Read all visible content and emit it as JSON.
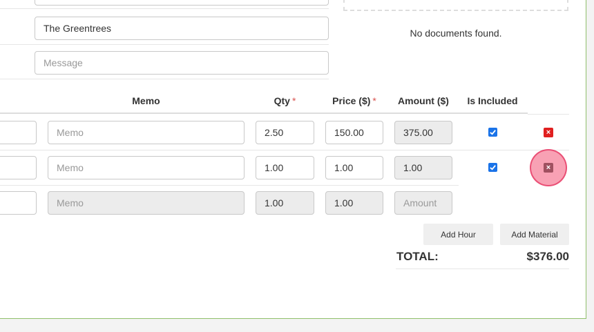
{
  "top_fields": {
    "field_1_value": "",
    "address_value": "The Greentrees",
    "message_placeholder": "Message"
  },
  "documents": {
    "empty_text": "No documents found."
  },
  "table": {
    "headers": {
      "memo": "Memo",
      "qty": "Qty",
      "price": "Price ($)",
      "amount": "Amount ($)",
      "included": "Is Included"
    },
    "required_marker": "*",
    "rows": [
      {
        "memo_placeholder": "Memo",
        "qty": "2.50",
        "price": "150.00",
        "amount": "375.00",
        "included": true
      },
      {
        "memo_placeholder": "Memo",
        "qty": "1.00",
        "price": "1.00",
        "amount": "1.00",
        "included": true
      },
      {
        "memo_placeholder": "Memo",
        "qty": "1.00",
        "price": "1.00",
        "amount_placeholder": "Amount"
      }
    ]
  },
  "actions": {
    "add_hour": "Add Hour",
    "add_material": "Add Material"
  },
  "totals": {
    "label": "TOTAL:",
    "value": "$376.00"
  },
  "colors": {
    "accent_border": "#8fbf6a",
    "checkbox": "#1a73e8",
    "delete": "#e02020",
    "required": "#d9534f"
  }
}
